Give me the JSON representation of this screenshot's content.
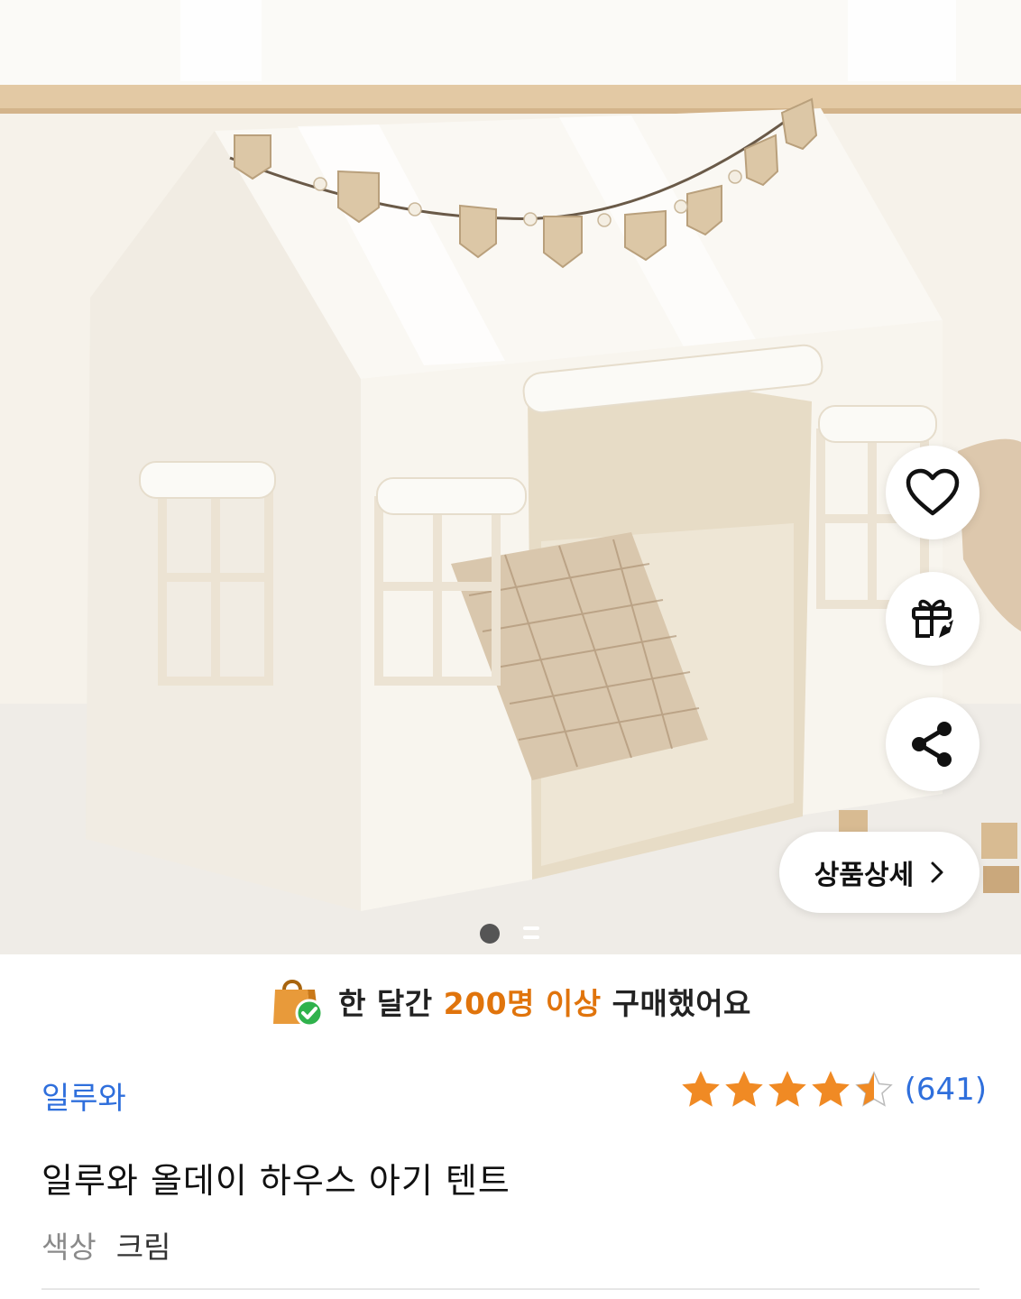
{
  "product_image": {
    "pager_count": 2,
    "pager_active": 1
  },
  "actions": {
    "wishlist_icon": "heart-icon",
    "gift_icon": "gift-rocket-icon",
    "share_icon": "share-icon",
    "detail_label": "상품상세",
    "detail_icon": "chevron-right-icon"
  },
  "promo": {
    "icon": "shopping-bag-check-icon",
    "prefix": "한 달간",
    "highlight": "200명 이상",
    "suffix": "구매했어요",
    "highlight_color": "#e0740c"
  },
  "product": {
    "brand": "일루와",
    "rating_stars": 4.5,
    "review_count": "(641)",
    "title": "일루와 올데이 하우스 아기 텐트",
    "option_label": "색상",
    "option_value": "크림"
  },
  "colors": {
    "link": "#2f6fdc",
    "star": "#f08a24",
    "accent": "#e0740c"
  }
}
